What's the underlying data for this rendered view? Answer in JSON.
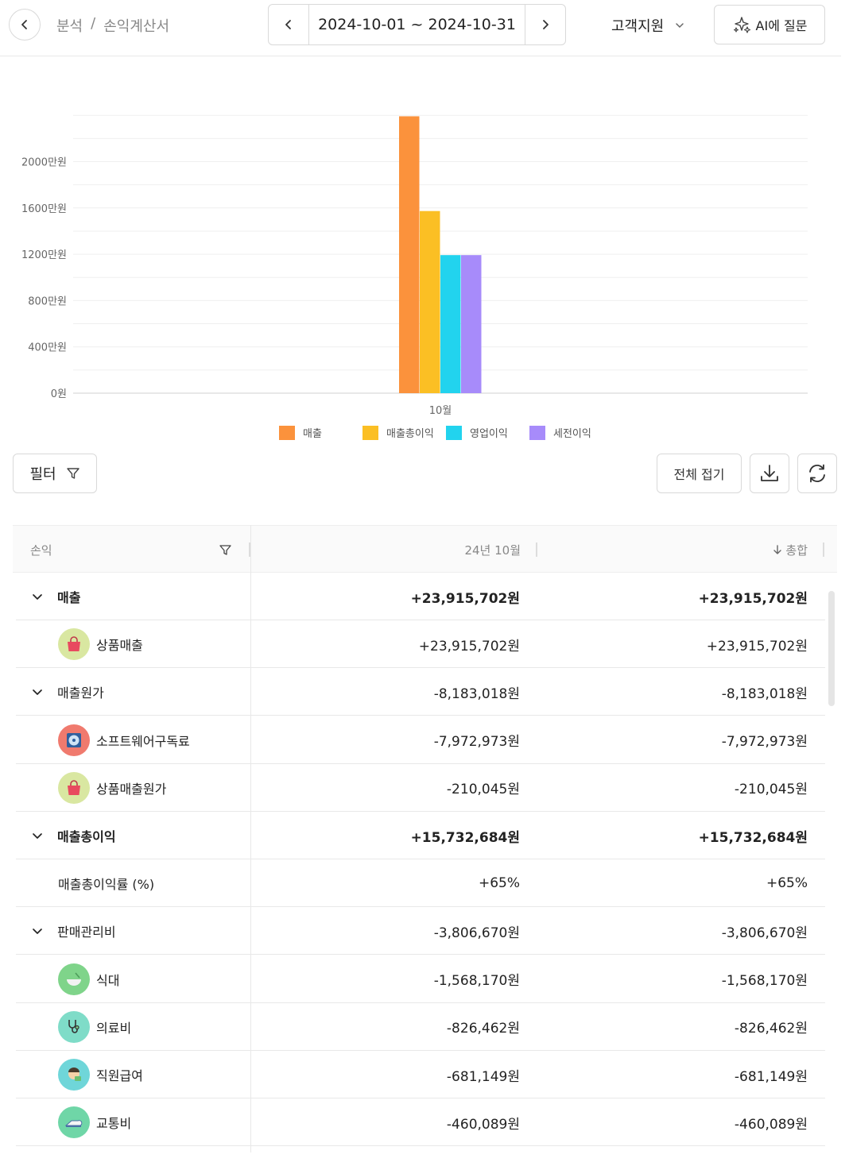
{
  "header": {
    "breadcrumb": [
      "분석",
      "/",
      "손익계산서"
    ],
    "date_range": "2024-10-01 ~ 2024-10-31",
    "department": "고객지원",
    "ai_button": "AI에 질문"
  },
  "colors": {
    "revenue": "#FB923C",
    "gross_profit": "#FBBF24",
    "operating_profit": "#22D3EE",
    "pretax_profit": "#A78BFA"
  },
  "chart_data": {
    "type": "bar",
    "categories": [
      "10월"
    ],
    "y_tick_labels": [
      "0원",
      "400만원",
      "800만원",
      "1200만원",
      "1600만원",
      "2000만원"
    ],
    "ylim": [
      0,
      24000000
    ],
    "series": [
      {
        "name": "매출",
        "values": [
          23915702
        ]
      },
      {
        "name": "매출총이익",
        "values": [
          15732684
        ]
      },
      {
        "name": "영업이익",
        "values": [
          11926014
        ]
      },
      {
        "name": "세전이익",
        "values": [
          11926014
        ]
      }
    ],
    "legend_position": "bottom"
  },
  "toolbar": {
    "filter_label": "필터",
    "collapse_label": "전체 접기"
  },
  "table": {
    "headers": {
      "account": "손익",
      "period": "24년 10월",
      "total": "총합"
    },
    "rows": [
      {
        "label": "매출",
        "v1": "+23,915,702원",
        "v2": "+23,915,702원"
      },
      {
        "label": "상품매출",
        "v1": "+23,915,702원",
        "v2": "+23,915,702원"
      },
      {
        "label": "매출원가",
        "v1": "-8,183,018원",
        "v2": "-8,183,018원"
      },
      {
        "label": "소프트웨어구독료",
        "v1": "-7,972,973원",
        "v2": "-7,972,973원"
      },
      {
        "label": "상품매출원가",
        "v1": "-210,045원",
        "v2": "-210,045원"
      },
      {
        "label": "매출총이익",
        "v1": "+15,732,684원",
        "v2": "+15,732,684원"
      },
      {
        "label": "매출총이익률 (%)",
        "v1": "+65%",
        "v2": "+65%"
      },
      {
        "label": "판매관리비",
        "v1": "-3,806,670원",
        "v2": "-3,806,670원"
      },
      {
        "label": "식대",
        "v1": "-1,568,170원",
        "v2": "-1,568,170원"
      },
      {
        "label": "의료비",
        "v1": "-826,462원",
        "v2": "-826,462원"
      },
      {
        "label": "직원급여",
        "v1": "-681,149원",
        "v2": "-681,149원"
      },
      {
        "label": "교통비",
        "v1": "-460,089원",
        "v2": "-460,089원"
      }
    ]
  }
}
